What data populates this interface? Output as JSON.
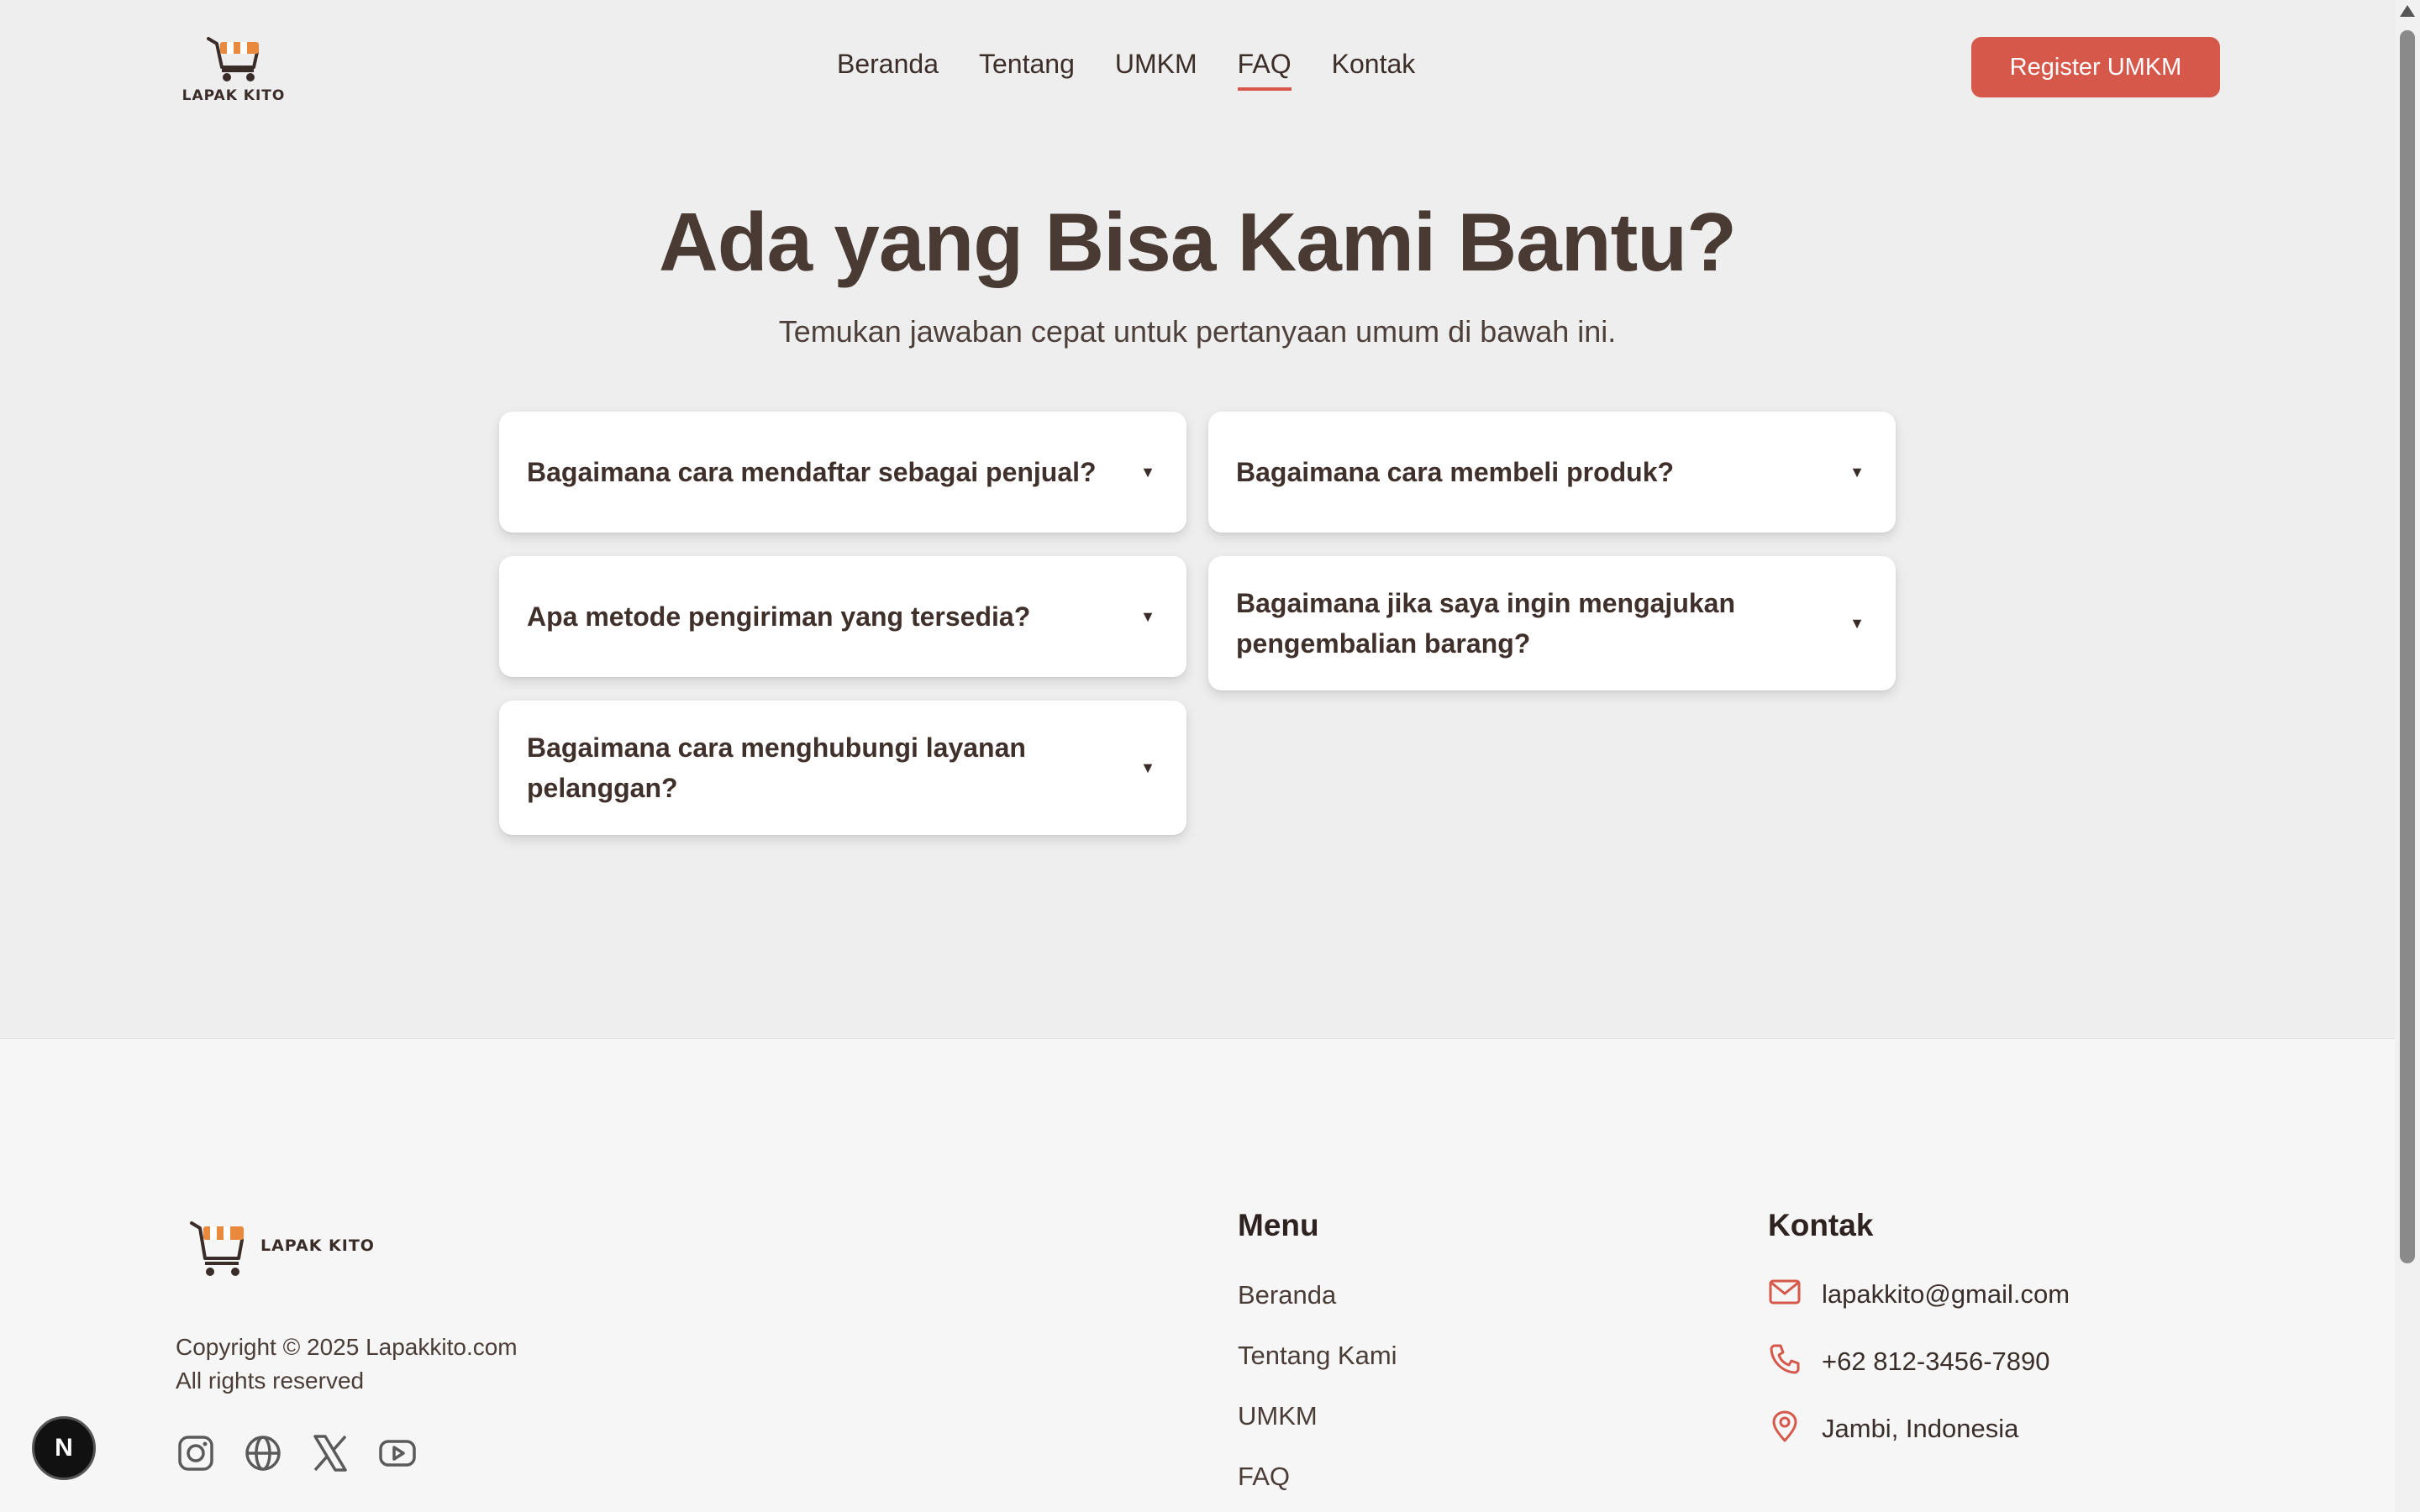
{
  "header": {
    "logo_text": "LAPAK KITO",
    "nav": [
      {
        "label": "Beranda"
      },
      {
        "label": "Tentang"
      },
      {
        "label": "UMKM"
      },
      {
        "label": "FAQ"
      },
      {
        "label": "Kontak"
      }
    ],
    "active_nav": "FAQ",
    "register_label": "Register UMKM"
  },
  "hero": {
    "title": "Ada yang Bisa Kami Bantu?",
    "subtitle": "Temukan jawaban cepat untuk pertanyaan umum di bawah ini."
  },
  "faq": {
    "arrow": "▼",
    "items": [
      {
        "question": "Bagaimana cara mendaftar sebagai penjual?"
      },
      {
        "question": "Bagaimana cara membeli produk?"
      },
      {
        "question": "Apa metode pengiriman yang tersedia?"
      },
      {
        "question": "Bagaimana jika saya ingin mengajukan pengembalian barang?"
      },
      {
        "question": "Bagaimana cara menghubungi layanan pelanggan?"
      }
    ]
  },
  "footer": {
    "logo_text": "LAPAK KITO",
    "copyright_line1": "Copyright © 2025 Lapakkito.com",
    "copyright_line2": "All rights reserved",
    "socials": [
      "instagram-icon",
      "globe-icon",
      "x-icon",
      "youtube-icon"
    ],
    "menu_heading": "Menu",
    "menu": [
      {
        "label": "Beranda"
      },
      {
        "label": "Tentang Kami"
      },
      {
        "label": "UMKM"
      },
      {
        "label": "FAQ"
      }
    ],
    "contact_heading": "Kontak",
    "contact": {
      "email": "lapakkito@gmail.com",
      "phone": "+62 812-3456-7890",
      "location": "Jambi, Indonesia"
    }
  },
  "badge": "N",
  "colors": {
    "accent": "#d6584b",
    "text_dark": "#4a3a34",
    "background": "#efeeee",
    "footer_bg": "#f6f6f6"
  }
}
